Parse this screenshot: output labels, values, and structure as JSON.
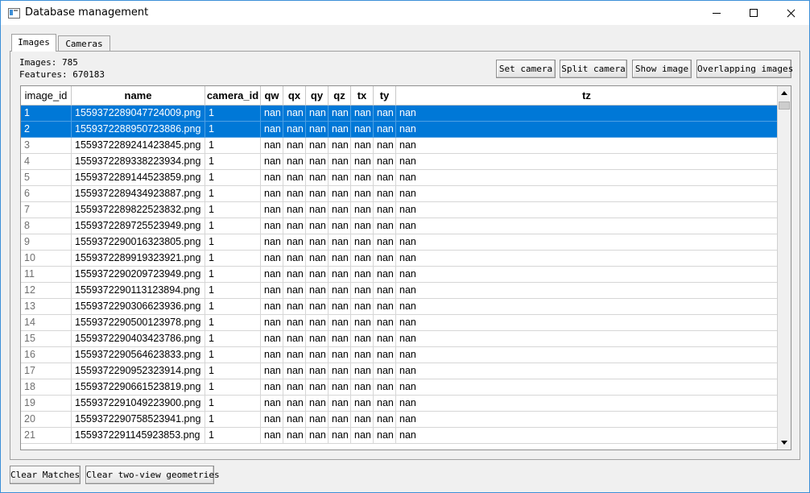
{
  "window": {
    "title": "Database management"
  },
  "tabs": [
    {
      "label": "Images",
      "active": true
    },
    {
      "label": "Cameras",
      "active": false
    }
  ],
  "info": {
    "images_text": "Images: 785",
    "features_text": "Features: 670183"
  },
  "toolbar": {
    "set_camera": "Set camera",
    "split_camera": "Split camera",
    "show_image": "Show image",
    "overlapping_images": "Overlapping images"
  },
  "table": {
    "columns": [
      "image_id",
      "name",
      "camera_id",
      "qw",
      "qx",
      "qy",
      "qz",
      "tx",
      "ty",
      "tz"
    ],
    "rows": [
      {
        "id": "1",
        "name": "1559372289047724009.png",
        "camera_id": "1",
        "qw": "nan",
        "qx": "nan",
        "qy": "nan",
        "qz": "nan",
        "tx": "nan",
        "ty": "nan",
        "tz": "nan",
        "selected": true
      },
      {
        "id": "2",
        "name": "1559372288950723886.png",
        "camera_id": "1",
        "qw": "nan",
        "qx": "nan",
        "qy": "nan",
        "qz": "nan",
        "tx": "nan",
        "ty": "nan",
        "tz": "nan",
        "selected": true
      },
      {
        "id": "3",
        "name": "1559372289241423845.png",
        "camera_id": "1",
        "qw": "nan",
        "qx": "nan",
        "qy": "nan",
        "qz": "nan",
        "tx": "nan",
        "ty": "nan",
        "tz": "nan",
        "selected": false
      },
      {
        "id": "4",
        "name": "1559372289338223934.png",
        "camera_id": "1",
        "qw": "nan",
        "qx": "nan",
        "qy": "nan",
        "qz": "nan",
        "tx": "nan",
        "ty": "nan",
        "tz": "nan",
        "selected": false
      },
      {
        "id": "5",
        "name": "1559372289144523859.png",
        "camera_id": "1",
        "qw": "nan",
        "qx": "nan",
        "qy": "nan",
        "qz": "nan",
        "tx": "nan",
        "ty": "nan",
        "tz": "nan",
        "selected": false
      },
      {
        "id": "6",
        "name": "1559372289434923887.png",
        "camera_id": "1",
        "qw": "nan",
        "qx": "nan",
        "qy": "nan",
        "qz": "nan",
        "tx": "nan",
        "ty": "nan",
        "tz": "nan",
        "selected": false
      },
      {
        "id": "7",
        "name": "1559372289822523832.png",
        "camera_id": "1",
        "qw": "nan",
        "qx": "nan",
        "qy": "nan",
        "qz": "nan",
        "tx": "nan",
        "ty": "nan",
        "tz": "nan",
        "selected": false
      },
      {
        "id": "8",
        "name": "1559372289725523949.png",
        "camera_id": "1",
        "qw": "nan",
        "qx": "nan",
        "qy": "nan",
        "qz": "nan",
        "tx": "nan",
        "ty": "nan",
        "tz": "nan",
        "selected": false
      },
      {
        "id": "9",
        "name": "1559372290016323805.png",
        "camera_id": "1",
        "qw": "nan",
        "qx": "nan",
        "qy": "nan",
        "qz": "nan",
        "tx": "nan",
        "ty": "nan",
        "tz": "nan",
        "selected": false
      },
      {
        "id": "10",
        "name": "1559372289919323921.png",
        "camera_id": "1",
        "qw": "nan",
        "qx": "nan",
        "qy": "nan",
        "qz": "nan",
        "tx": "nan",
        "ty": "nan",
        "tz": "nan",
        "selected": false
      },
      {
        "id": "11",
        "name": "1559372290209723949.png",
        "camera_id": "1",
        "qw": "nan",
        "qx": "nan",
        "qy": "nan",
        "qz": "nan",
        "tx": "nan",
        "ty": "nan",
        "tz": "nan",
        "selected": false
      },
      {
        "id": "12",
        "name": "1559372290113123894.png",
        "camera_id": "1",
        "qw": "nan",
        "qx": "nan",
        "qy": "nan",
        "qz": "nan",
        "tx": "nan",
        "ty": "nan",
        "tz": "nan",
        "selected": false
      },
      {
        "id": "13",
        "name": "1559372290306623936.png",
        "camera_id": "1",
        "qw": "nan",
        "qx": "nan",
        "qy": "nan",
        "qz": "nan",
        "tx": "nan",
        "ty": "nan",
        "tz": "nan",
        "selected": false
      },
      {
        "id": "14",
        "name": "1559372290500123978.png",
        "camera_id": "1",
        "qw": "nan",
        "qx": "nan",
        "qy": "nan",
        "qz": "nan",
        "tx": "nan",
        "ty": "nan",
        "tz": "nan",
        "selected": false
      },
      {
        "id": "15",
        "name": "1559372290403423786.png",
        "camera_id": "1",
        "qw": "nan",
        "qx": "nan",
        "qy": "nan",
        "qz": "nan",
        "tx": "nan",
        "ty": "nan",
        "tz": "nan",
        "selected": false
      },
      {
        "id": "16",
        "name": "1559372290564623833.png",
        "camera_id": "1",
        "qw": "nan",
        "qx": "nan",
        "qy": "nan",
        "qz": "nan",
        "tx": "nan",
        "ty": "nan",
        "tz": "nan",
        "selected": false
      },
      {
        "id": "17",
        "name": "1559372290952323914.png",
        "camera_id": "1",
        "qw": "nan",
        "qx": "nan",
        "qy": "nan",
        "qz": "nan",
        "tx": "nan",
        "ty": "nan",
        "tz": "nan",
        "selected": false
      },
      {
        "id": "18",
        "name": "1559372290661523819.png",
        "camera_id": "1",
        "qw": "nan",
        "qx": "nan",
        "qy": "nan",
        "qz": "nan",
        "tx": "nan",
        "ty": "nan",
        "tz": "nan",
        "selected": false
      },
      {
        "id": "19",
        "name": "1559372291049223900.png",
        "camera_id": "1",
        "qw": "nan",
        "qx": "nan",
        "qy": "nan",
        "qz": "nan",
        "tx": "nan",
        "ty": "nan",
        "tz": "nan",
        "selected": false
      },
      {
        "id": "20",
        "name": "1559372290758523941.png",
        "camera_id": "1",
        "qw": "nan",
        "qx": "nan",
        "qy": "nan",
        "qz": "nan",
        "tx": "nan",
        "ty": "nan",
        "tz": "nan",
        "selected": false
      },
      {
        "id": "21",
        "name": "1559372291145923853.png",
        "camera_id": "1",
        "qw": "nan",
        "qx": "nan",
        "qy": "nan",
        "qz": "nan",
        "tx": "nan",
        "ty": "nan",
        "tz": "nan",
        "selected": false
      }
    ]
  },
  "footer": {
    "clear_matches": "Clear Matches",
    "clear_two_view": "Clear two-view geometries"
  },
  "colors": {
    "selection": "#0078d7",
    "window_border": "#3c8fd8",
    "dialog_bg": "#f0f0f0"
  }
}
